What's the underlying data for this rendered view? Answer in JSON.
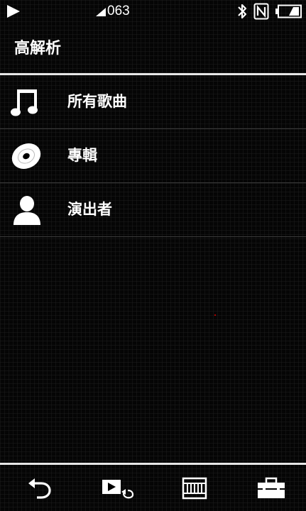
{
  "status_bar": {
    "volume_level": "063"
  },
  "header": {
    "title": "高解析"
  },
  "menu": {
    "items": [
      {
        "label": "所有歌曲",
        "icon": "music-note-icon"
      },
      {
        "label": "專輯",
        "icon": "disc-icon"
      },
      {
        "label": "演出者",
        "icon": "person-icon"
      }
    ]
  },
  "bottom_bar": {
    "buttons": [
      {
        "icon": "back-arrow-icon"
      },
      {
        "icon": "now-playing-return-icon"
      },
      {
        "icon": "library-icon"
      },
      {
        "icon": "toolbox-icon"
      }
    ]
  },
  "colors": {
    "background": "#000000",
    "text": "#ffffff",
    "divider": "#e6e6e6",
    "row_separator": "#3a3a3a"
  }
}
